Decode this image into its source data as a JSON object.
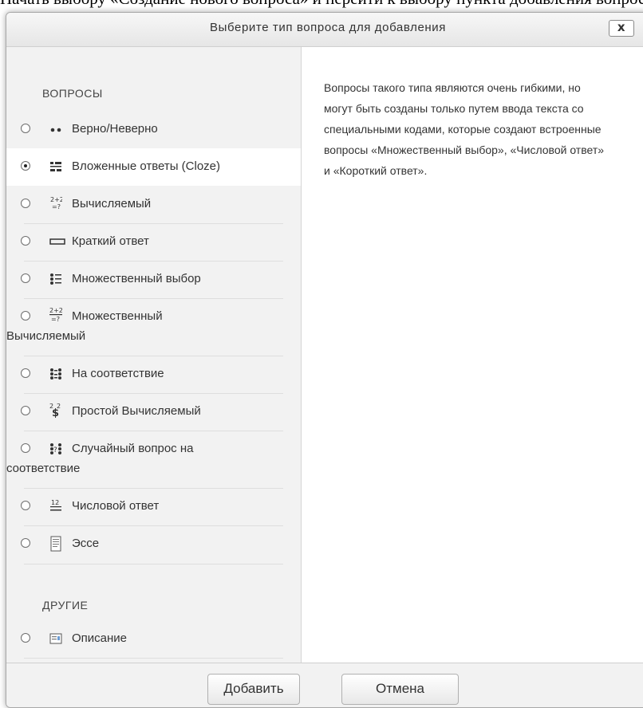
{
  "background": {
    "text": "Начать выбору «Создание нового вопроса» и перейти к выбору пункта добавления вопроса"
  },
  "dialog": {
    "title": "Выберите тип вопроса для добавления",
    "close_label": "x",
    "description": "Вопросы такого типа являются очень гибкими, но могут быть созданы только путем ввода текста со специальными кодами, которые создают встроенные вопросы «Множественный выбор», «Числовой ответ» и «Короткий ответ».",
    "sections": {
      "questions_heading": "ВОПРОСЫ",
      "other_heading": "ДРУГИЕ"
    },
    "options": [
      {
        "label": "Верно/Неверно",
        "icon": "true-false-icon",
        "selected": false
      },
      {
        "label": "Вложенные ответы (Cloze)",
        "icon": "cloze-icon",
        "selected": true
      },
      {
        "label": "Вычисляемый",
        "icon": "calculated-icon",
        "selected": false
      },
      {
        "label": "Краткий ответ",
        "icon": "short-answer-icon",
        "selected": false
      },
      {
        "label": "Множественный выбор",
        "icon": "multiple-choice-icon",
        "selected": false
      },
      {
        "label_line1": "Множественный",
        "label_line2": "Вычисляемый",
        "icon": "calculated-multi-icon",
        "selected": false
      },
      {
        "label": "На соответствие",
        "icon": "matching-icon",
        "selected": false
      },
      {
        "label": "Простой Вычисляемый",
        "icon": "calculated-simple-icon",
        "selected": false
      },
      {
        "label_line1": "Случайный вопрос на",
        "label_line2": "соответствие",
        "icon": "random-matching-icon",
        "selected": false
      },
      {
        "label": "Числовой ответ",
        "icon": "numerical-icon",
        "selected": false
      },
      {
        "label": "Эссе",
        "icon": "essay-icon",
        "selected": false
      },
      {
        "label": "Описание",
        "icon": "description-icon",
        "selected": false
      }
    ],
    "buttons": {
      "add": "Добавить",
      "cancel": "Отмена"
    }
  }
}
